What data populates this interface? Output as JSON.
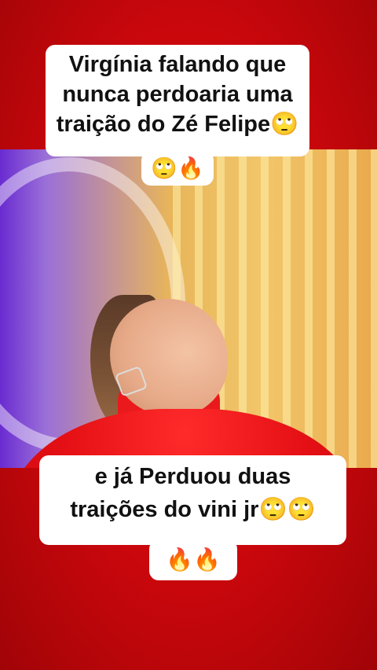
{
  "top_caption": {
    "line1": "Virgínia falando que",
    "line2": "nunca perdoaria uma",
    "line3": "traição do Zé Felipe🙄",
    "line4": "🙄🔥"
  },
  "bottom_caption": {
    "line1": "e já Perduou duas",
    "line2": "traições do vini jr🙄🙄",
    "line3": "🔥🔥"
  },
  "colors": {
    "background_red": "#d10a0f",
    "caption_bg": "#ffffff",
    "caption_text": "#111111",
    "dress_red": "#e30f14"
  }
}
